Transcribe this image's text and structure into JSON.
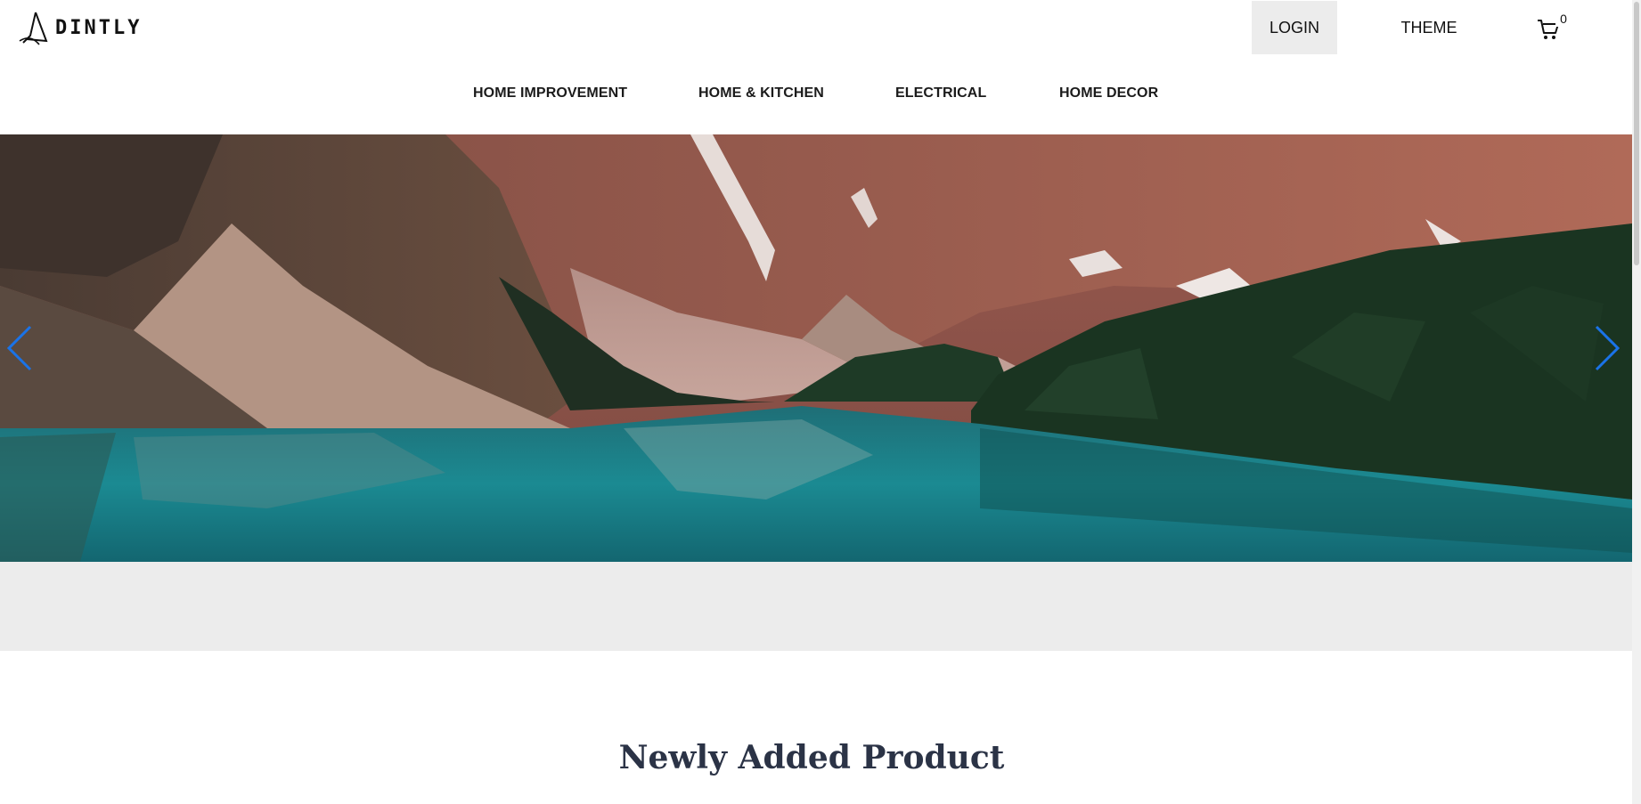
{
  "brand": {
    "name": "DINTLY",
    "logo_icon": "triangle-swirl-logo"
  },
  "header": {
    "login_label": "LOGIN",
    "theme_label": "THEME",
    "cart": {
      "icon": "cart-icon",
      "count": "0"
    }
  },
  "categories": [
    {
      "label": "HOME IMPROVEMENT"
    },
    {
      "label": "HOME & KITCHEN"
    },
    {
      "label": "ELECTRICAL"
    },
    {
      "label": "HOME DECOR"
    }
  ],
  "hero": {
    "prev_icon": "chevron-left-icon",
    "next_icon": "chevron-right-icon",
    "arrow_color": "#1a73e8"
  },
  "section": {
    "title": "Newly Added Product"
  }
}
